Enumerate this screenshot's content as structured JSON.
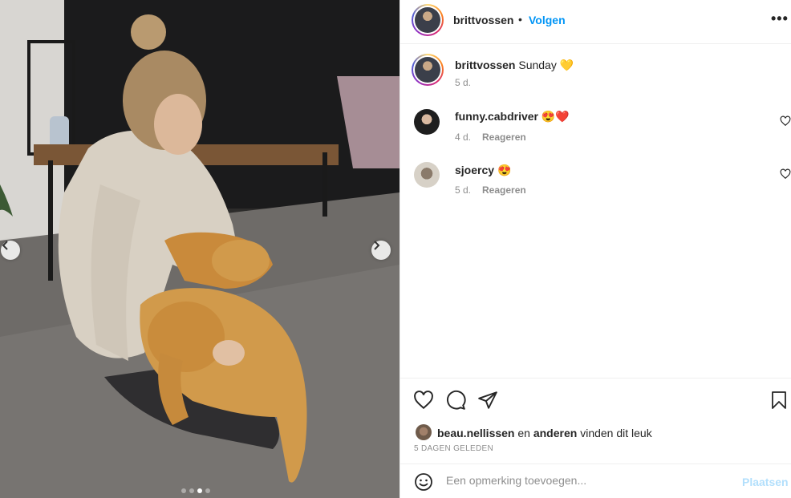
{
  "header": {
    "username": "brittvossen",
    "separator": "•",
    "follow_label": "Volgen",
    "more_label": "•••"
  },
  "caption": {
    "username": "brittvossen",
    "text": "Sunday 💛",
    "age": "5 d."
  },
  "comments": [
    {
      "username": "funny.cabdriver",
      "text": "😍❤️",
      "age": "4 d.",
      "reply_label": "Reageren"
    },
    {
      "username": "sjoercy",
      "text": "😍",
      "age": "5 d.",
      "reply_label": "Reageren"
    }
  ],
  "likes": {
    "first_user": "beau.nellissen",
    "connector": "en",
    "others": "anderen",
    "suffix": "vinden dit leuk"
  },
  "posted_date": "5 DAGEN GELEDEN",
  "comment_box": {
    "placeholder": "Een opmerking toevoegen...",
    "post_label": "Plaatsen"
  },
  "carousel": {
    "total": 4,
    "active_index": 2
  },
  "colors": {
    "link": "#0095f6",
    "muted": "#8e8e8e",
    "post_disabled": "#b2dffc"
  },
  "icons": [
    "chevron-left-icon",
    "chevron-right-icon",
    "heart-icon",
    "comment-icon",
    "share-icon",
    "bookmark-icon",
    "emoji-icon",
    "more-icon"
  ]
}
